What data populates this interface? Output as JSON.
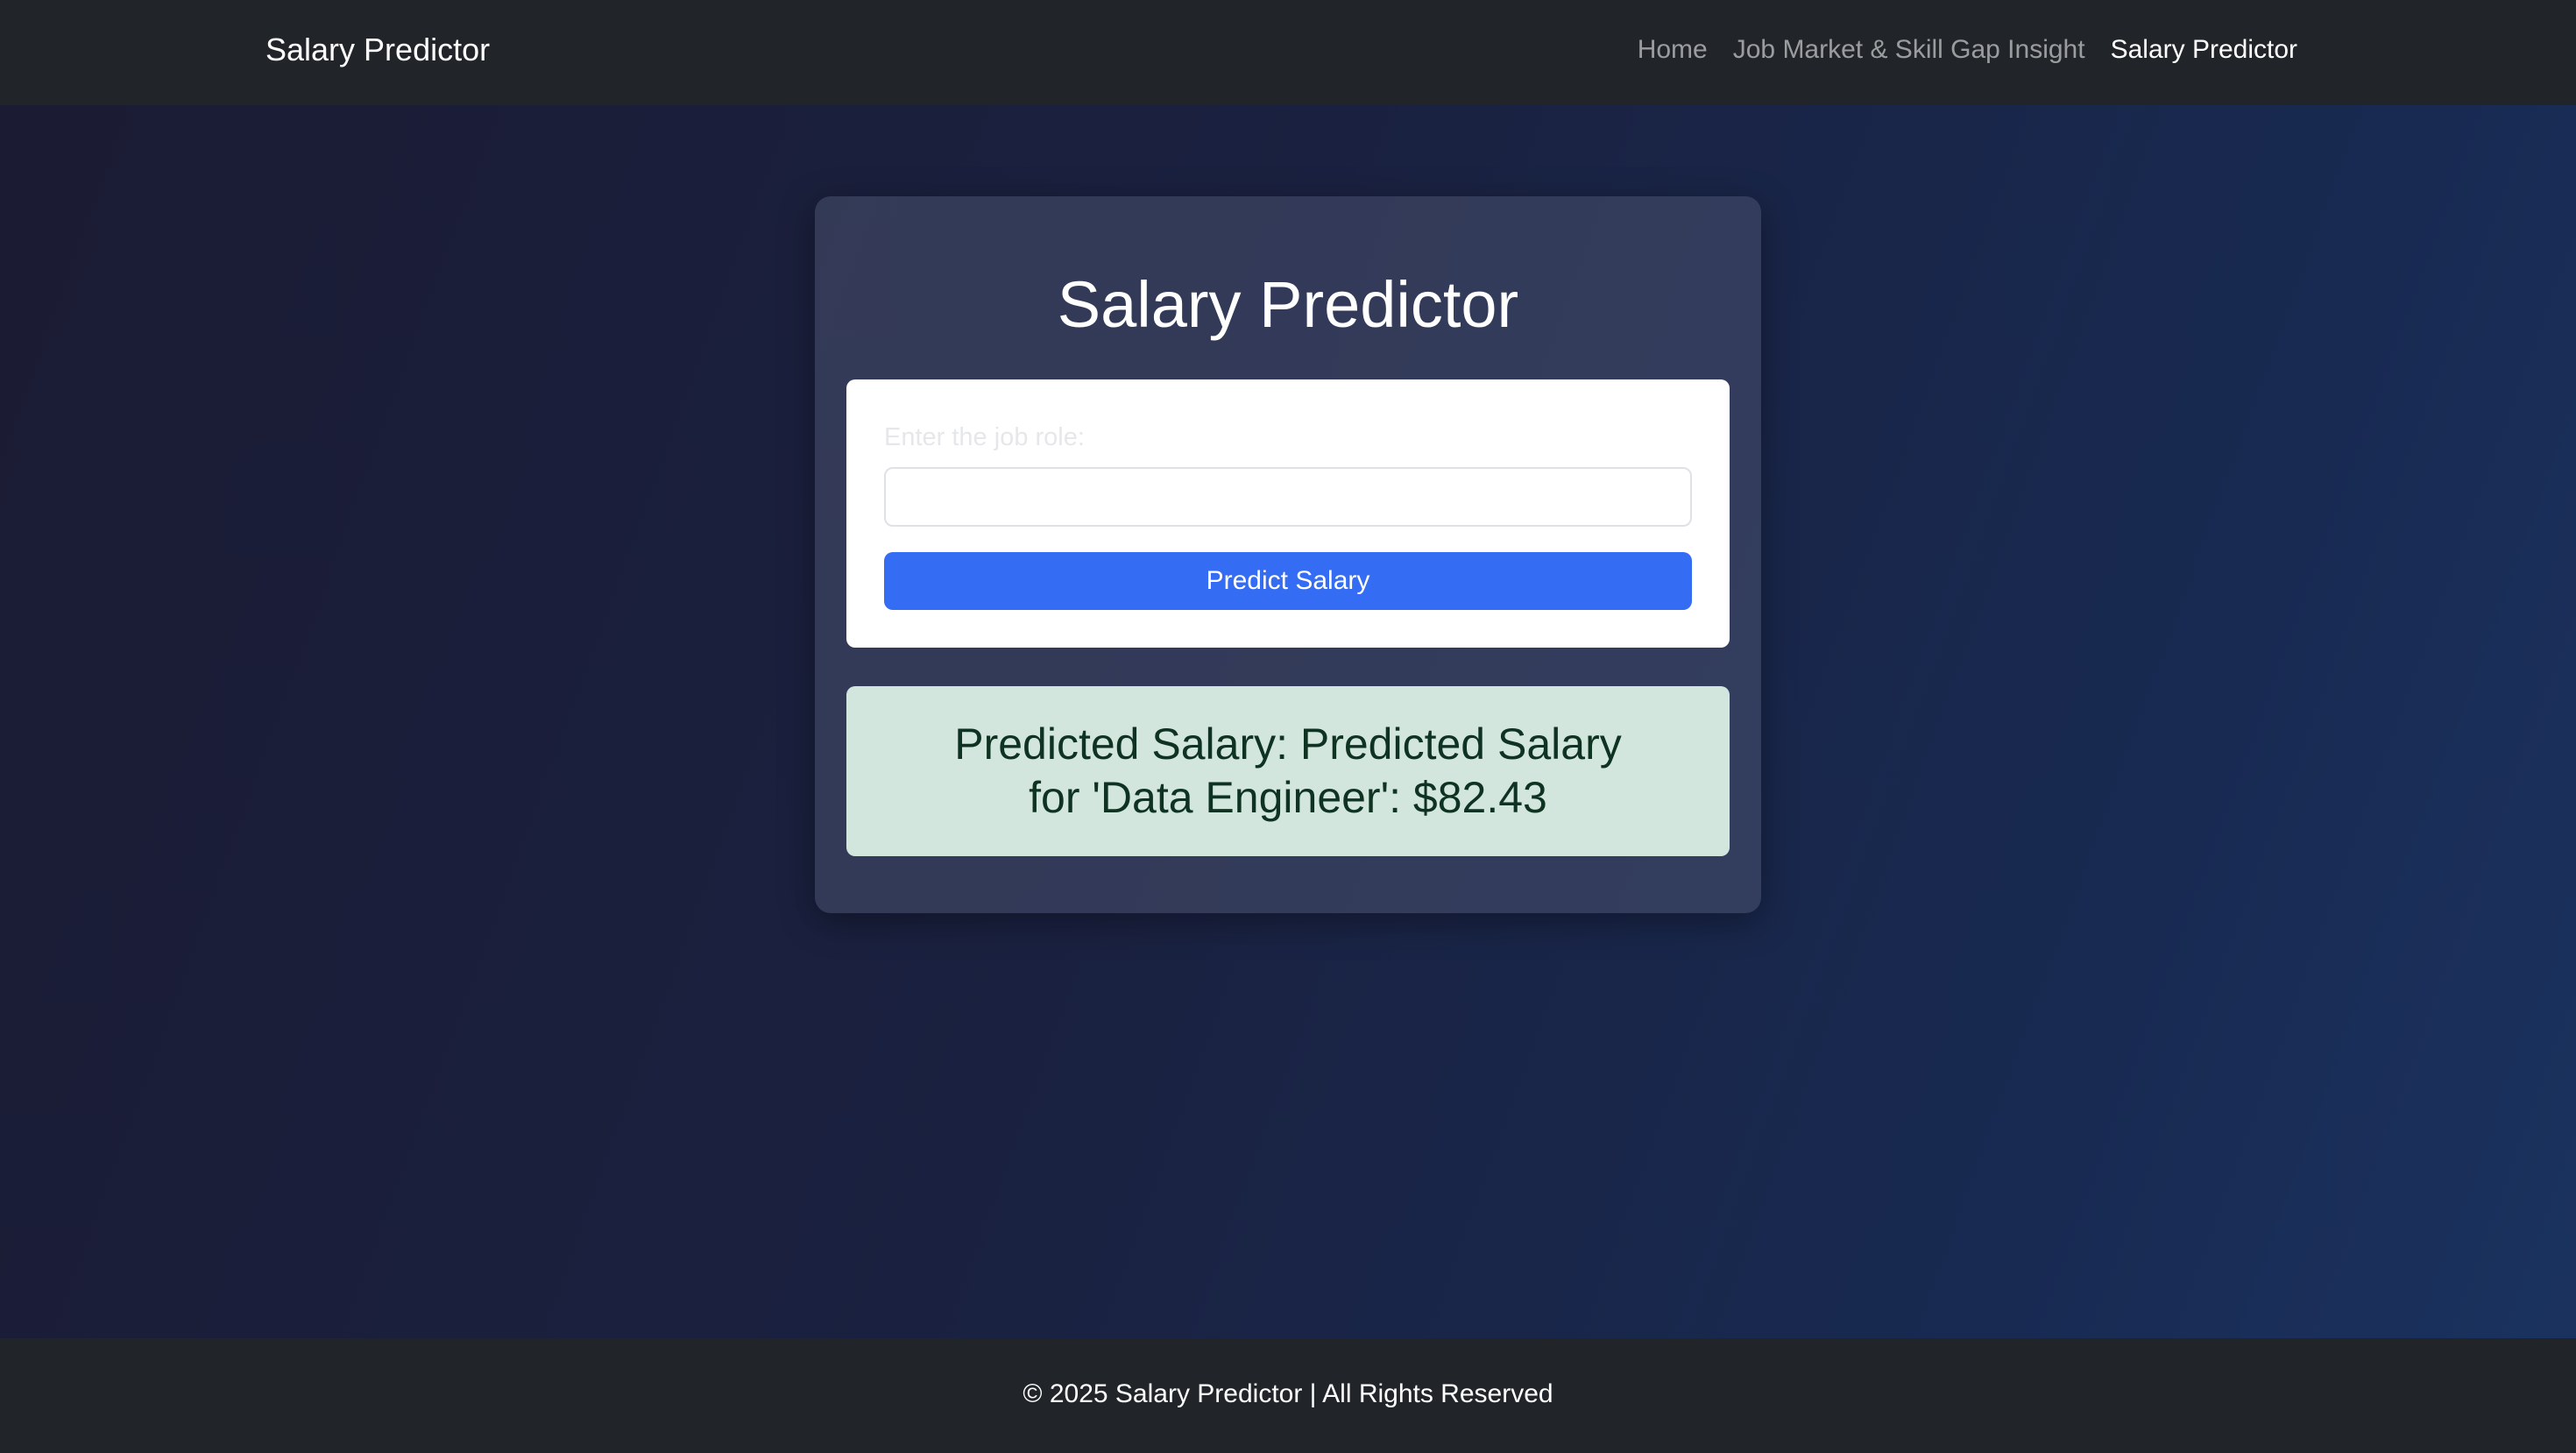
{
  "navbar": {
    "brand": "Salary Predictor",
    "links": [
      {
        "label": "Home",
        "active": false
      },
      {
        "label": "Job Market & Skill Gap Insight",
        "active": false
      },
      {
        "label": "Salary Predictor",
        "active": true
      }
    ]
  },
  "main": {
    "title": "Salary Predictor",
    "form": {
      "label": "Enter the job role:",
      "input_value": "",
      "button_label": "Predict Salary"
    },
    "result": {
      "text": "Predicted Salary: Predicted Salary for 'Data Engineer': $82.43"
    }
  },
  "footer": {
    "text": "© 2025 Salary Predictor | All Rights Reserved"
  },
  "colors": {
    "navbar_bg": "#212529",
    "button_bg": "#346cf3",
    "result_bg": "#d3e6dd",
    "result_text": "#0f3322"
  }
}
